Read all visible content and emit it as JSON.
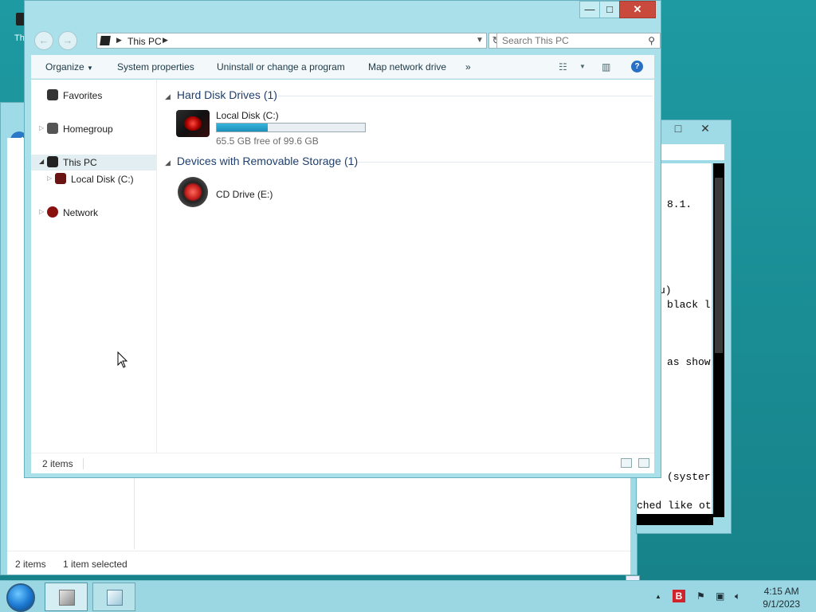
{
  "desktop": {
    "icon_label": "Th"
  },
  "background_window": {
    "status_items": "2 items",
    "status_selected": "1 item selected"
  },
  "console_window": {
    "lines": [
      "8.1.",
      "u)",
      "black l",
      "as show",
      "(syster",
      "ched like ot"
    ]
  },
  "window": {
    "caption": {
      "minimize": "—",
      "maximize": "□",
      "close": "✕"
    },
    "address": {
      "location": "This PC",
      "search_placeholder": "Search This PC"
    },
    "toolbar": {
      "organize": "Organize",
      "system_properties": "System properties",
      "uninstall": "Uninstall or change a program",
      "map_drive": "Map network drive",
      "more": "»",
      "help": "?"
    },
    "nav_pane": {
      "favorites": "Favorites",
      "homegroup": "Homegroup",
      "this_pc": "This PC",
      "local_disk": "Local Disk (C:)",
      "network": "Network"
    },
    "groups": {
      "hard_disk": "Hard Disk Drives (1)",
      "removable": "Devices with Removable Storage (1)"
    },
    "drives": {
      "c_name": "Local Disk (C:)",
      "c_free": "65.5 GB free of 99.6 GB",
      "c_used_fraction": 0.342,
      "e_name": "CD Drive (E:)"
    },
    "status": {
      "items": "2 items"
    }
  },
  "taskbar": {
    "time": "4:15 AM",
    "date": "9/1/2023",
    "badge": "B"
  },
  "colors": {
    "progress": "#1c8fb8",
    "accent": "#a9e0ea",
    "close": "#c94a3c"
  }
}
